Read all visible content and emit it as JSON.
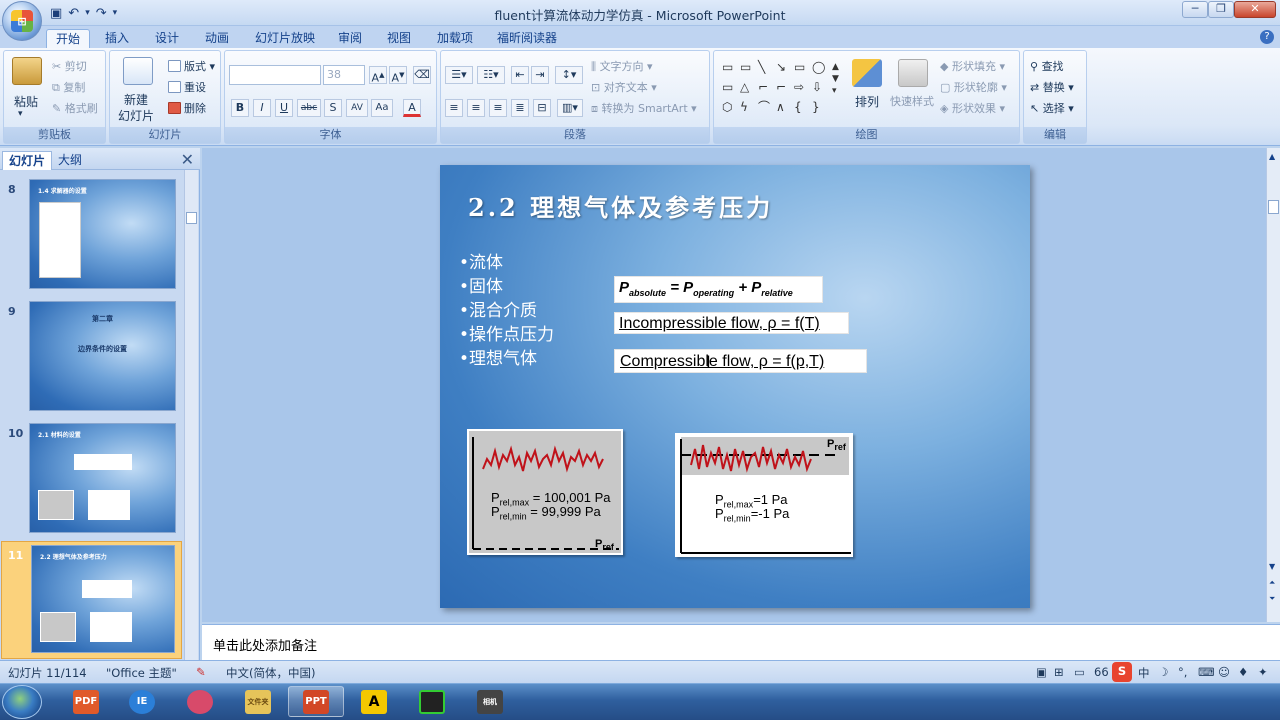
{
  "window": {
    "title": "fluent计算流体动力学仿真 - Microsoft PowerPoint",
    "qat_icons": [
      "save-icon",
      "undo-icon",
      "redo-icon"
    ],
    "controls": [
      "─",
      "❐",
      "✕"
    ]
  },
  "ribbon": {
    "tabs": [
      "开始",
      "插入",
      "设计",
      "动画",
      "幻灯片放映",
      "审阅",
      "视图",
      "加载项",
      "福昕阅读器"
    ],
    "active_tab": "开始",
    "clipboard": {
      "paste": "粘贴",
      "cut": "剪切",
      "copy": "复制",
      "format_painter": "格式刷",
      "label": "剪贴板"
    },
    "slides": {
      "new_slide": "新建",
      "new_slide2": "幻灯片",
      "layout": "版式",
      "reset": "重设",
      "delete": "删除",
      "label": "幻灯片"
    },
    "font": {
      "size": "38",
      "buttons": [
        "B",
        "I",
        "U",
        "abc",
        "S",
        "AV",
        "Aa",
        "A"
      ],
      "label": "字体"
    },
    "paragraph": {
      "text_direction": "文字方向",
      "align_text": "对齐文本",
      "smartart": "转换为 SmartArt",
      "label": "段落"
    },
    "drawing": {
      "arrange": "排列",
      "quick_styles": "快速样式",
      "shape_fill": "形状填充",
      "shape_outline": "形状轮廓",
      "shape_effects": "形状效果",
      "label": "绘图"
    },
    "editing": {
      "find": "查找",
      "replace": "替换",
      "select": "选择",
      "label": "编辑"
    }
  },
  "left_panel": {
    "tabs": [
      "幻灯片",
      "大纲"
    ],
    "thumbnails": [
      {
        "num": "8",
        "title": "1.4 求解器的设置"
      },
      {
        "num": "9",
        "title": "第二章",
        "subtitle": "边界条件的设置"
      },
      {
        "num": "10",
        "title": "2.1 材料的设置"
      },
      {
        "num": "11",
        "title": "2.2 理想气体及参考压力"
      }
    ]
  },
  "slide": {
    "title": "2.2 理想气体及参考压力",
    "bullets": [
      "•流体",
      "•固体",
      "•混合介质",
      "•操作点压力",
      "•理想气体"
    ],
    "formula_main": "P",
    "formula_sub1": "absolute",
    "formula_eq": " = P",
    "formula_sub2": "operating",
    "formula_plus": " + P",
    "formula_sub3": "relative",
    "incompressible": "Incompressible flow, ρ = f(T)",
    "compressible": "Compressible flow, ρ = f(p,T)",
    "plot1": {
      "l1": "P",
      "s1": "rel,max",
      "v1": " = 100,001 Pa",
      "l2": "P",
      "s2": "rel,min",
      "v2": " = 99,999 Pa",
      "ref": "P",
      "refsub": "ref"
    },
    "plot2": {
      "l1": "P",
      "s1": "rel,max",
      "v1": "=1 Pa",
      "l2": "P",
      "s2": "rel,min",
      "v2": "=-1 Pa",
      "ref": "P",
      "refsub": "ref"
    }
  },
  "notes": {
    "placeholder": "单击此处添加备注"
  },
  "status": {
    "slide": "幻灯片 11/114",
    "theme": "\"Office 主题\"",
    "language": "中文(简体，中国)",
    "zoom": "66"
  },
  "taskbar": [
    "PDF",
    "IE",
    "",
    "文件夹",
    "PPT",
    "A",
    "",
    "相机"
  ]
}
